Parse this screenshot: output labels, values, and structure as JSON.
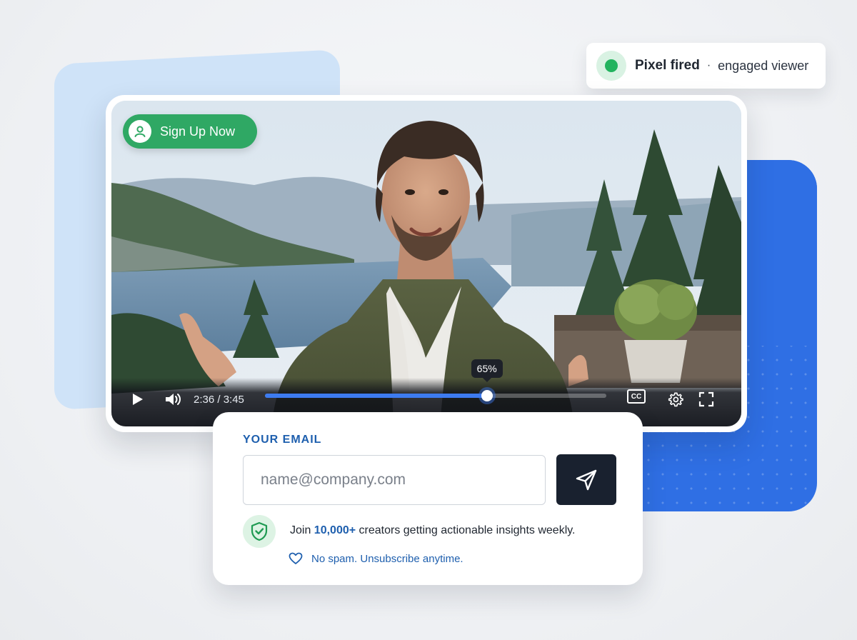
{
  "toast": {
    "status": "Pixel fired",
    "separator": "·",
    "detail": "engaged viewer",
    "status_color": "#22b35e"
  },
  "video": {
    "cta_label": "Sign Up Now",
    "current_time": "2:36",
    "duration": "3:45",
    "time_display": "2:36 / 3:45",
    "progress_percent": 65,
    "progress_label": "65%",
    "cc_label": "CC",
    "icons": [
      "play-icon",
      "volume-icon",
      "cc-icon",
      "settings-icon",
      "fullscreen-icon",
      "user-icon"
    ],
    "accent_color": "#3d7bf0",
    "cta_color": "#2fa864"
  },
  "signup": {
    "label": "YOUR EMAIL",
    "email_placeholder": "name@company.com",
    "email_value": "",
    "join_prefix": "Join ",
    "join_count": "10,000+",
    "join_suffix": " creators getting actionable insights weekly.",
    "nospam_text": "No spam. Unsubscribe anytime.",
    "brand_color": "#1e5fae"
  }
}
